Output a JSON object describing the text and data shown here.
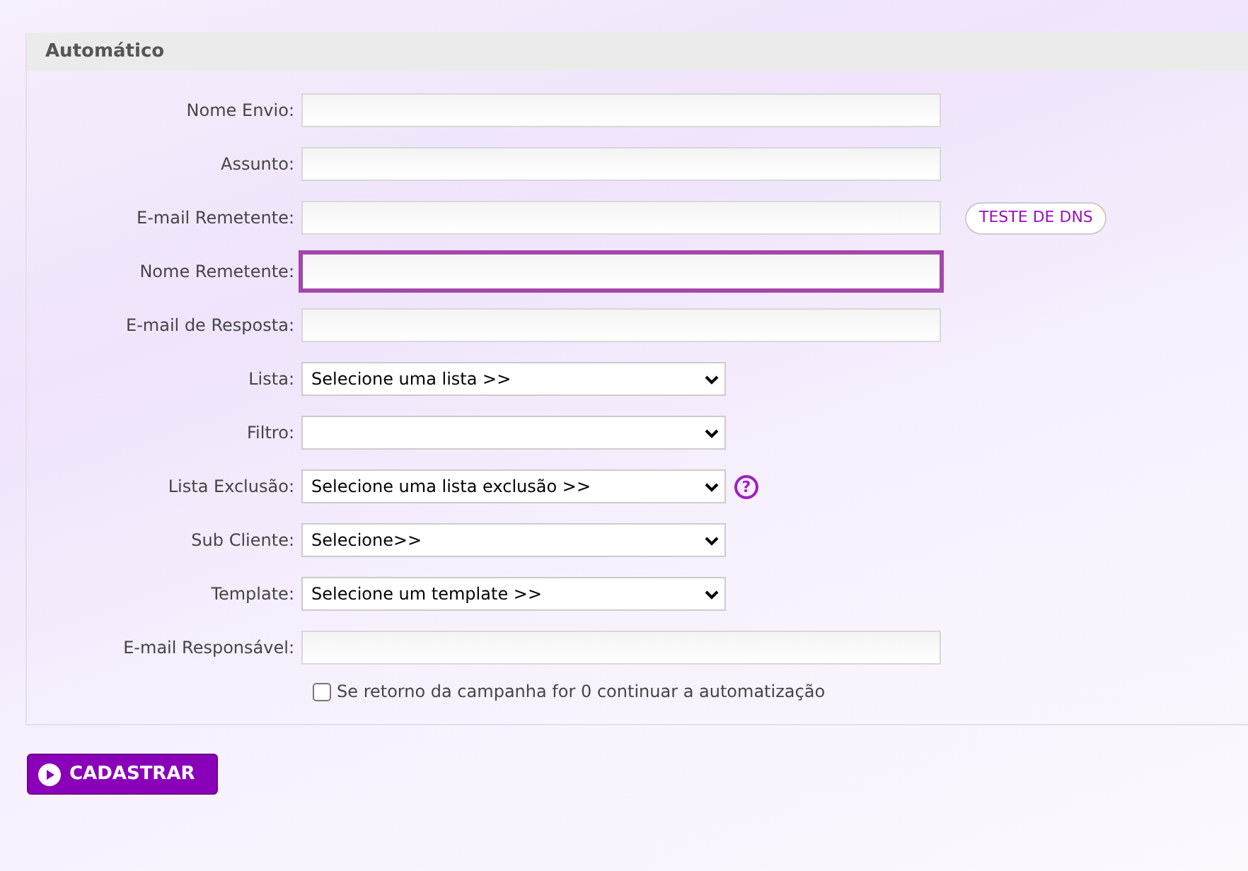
{
  "section": {
    "title": "Automático"
  },
  "fields": [
    {
      "kind": "text",
      "label": "Nome Envio:",
      "focused": false
    },
    {
      "kind": "text",
      "label": "Assunto:",
      "focused": false
    },
    {
      "kind": "text",
      "label": "E-mail Remetente:",
      "focused": false,
      "action": "TESTE DE DNS"
    },
    {
      "kind": "text",
      "label": "Nome Remetente:",
      "focused": true
    },
    {
      "kind": "text",
      "label": "E-mail de Resposta:",
      "focused": false
    },
    {
      "kind": "select",
      "label": "Lista:",
      "value": "Selecione uma lista >>"
    },
    {
      "kind": "select",
      "label": "Filtro:"
    },
    {
      "kind": "select",
      "label": "Lista Exclusão:",
      "value": "Selecione uma lista exclusão >>",
      "help": "?"
    },
    {
      "kind": "select",
      "label": "Sub Cliente:",
      "value": "Selecione>>"
    },
    {
      "kind": "select",
      "label": "Template:",
      "value": "Selecione um template >>"
    },
    {
      "kind": "text",
      "label": "E-mail Responsável:",
      "focused": false
    }
  ],
  "checkbox": {
    "label": "Se retorno da campanha for 0 continuar a automatização",
    "checked": false
  },
  "submit": {
    "label": "CADASTRAR"
  }
}
